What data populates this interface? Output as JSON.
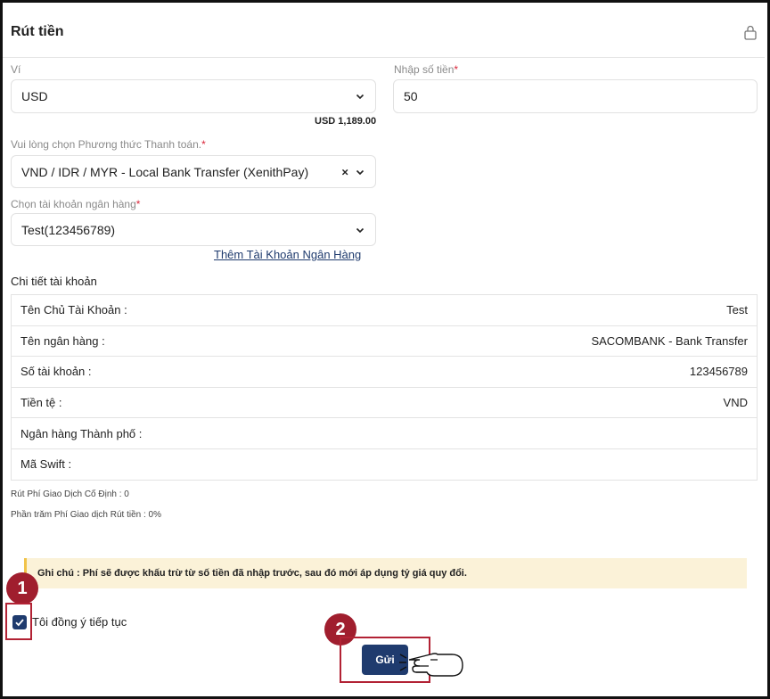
{
  "header": {
    "title": "Rút tiền",
    "lock_icon": "lock-icon"
  },
  "wallet": {
    "label": "Ví",
    "value": "USD",
    "balance": "USD 1,189.00"
  },
  "amount": {
    "label": "Nhập số tiền",
    "required": "*",
    "value": "50"
  },
  "payment_method": {
    "label": "Vui lòng chọn Phương thức Thanh toán.",
    "required": "*",
    "value": "VND / IDR / MYR - Local Bank Transfer (XenithPay)",
    "clear": "×"
  },
  "bank_account": {
    "label": "Chọn tài khoản ngân hàng",
    "required": "*",
    "value": "Test(123456789)",
    "add_link": "Thêm Tài Khoản Ngân Hàng"
  },
  "details": {
    "title": "Chi tiết tài khoản",
    "rows": [
      {
        "key": "Tên Chủ Tài Khoản :",
        "value": "Test"
      },
      {
        "key": "Tên ngân hàng :",
        "value": "SACOMBANK - Bank Transfer"
      },
      {
        "key": "Số tài khoản :",
        "value": "123456789"
      },
      {
        "key": "Tiền tệ :",
        "value": "VND"
      },
      {
        "key": "Ngân hàng Thành phố :",
        "value": ""
      },
      {
        "key": "Mã Swift :",
        "value": ""
      }
    ]
  },
  "fees": {
    "fixed": "Rút Phí Giao Dịch Cố Định : 0",
    "percent": "Phần trăm Phí Giao dịch Rút tiền : 0%"
  },
  "note": {
    "text": "Ghi chú : Phí sẽ được khấu trừ từ số tiền đã nhập trước, sau đó mới áp dụng tỷ giá quy đổi."
  },
  "agree": {
    "label": "Tôi đồng ý tiếp tục",
    "checked": true
  },
  "submit": {
    "label": "Gửi"
  },
  "annotations": {
    "step1": "1",
    "step2": "2"
  },
  "colors": {
    "primary": "#1f3b6e",
    "annotation": "#a01e2e",
    "note_bg": "#fbf2d8",
    "required": "#d9263a"
  }
}
